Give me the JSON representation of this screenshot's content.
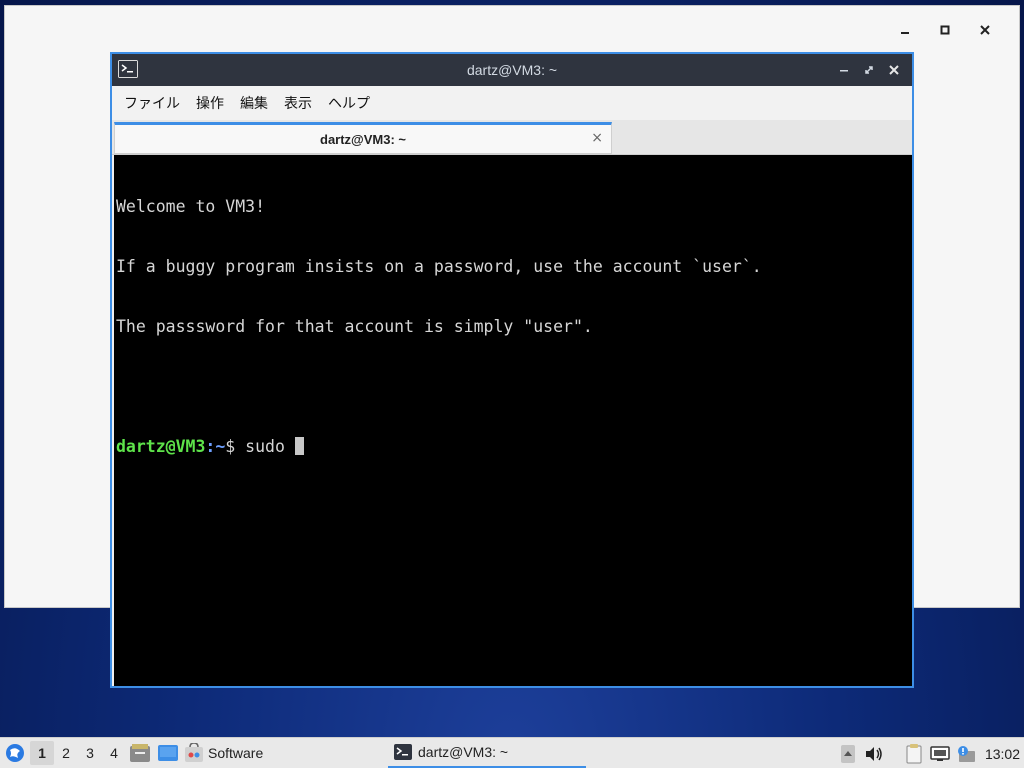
{
  "terminal_window": {
    "title": "dartz@VM3: ~",
    "menu": [
      "ファイル",
      "操作",
      "編集",
      "表示",
      "ヘルプ"
    ],
    "tab_label": "dartz@VM3: ~",
    "tab_close": "×",
    "lines": [
      "Welcome to VM3!",
      "If a buggy program insists on a password, use the account `user`.",
      "The passsword for that account is simply \"user\".",
      ""
    ],
    "prompt": {
      "user_host": "dartz@VM3",
      "sep": ":",
      "path": "~",
      "symbol": "$ ",
      "command": "sudo "
    }
  },
  "taskbar": {
    "workspaces": [
      "1",
      "2",
      "3",
      "4"
    ],
    "active_workspace": "1",
    "software_label": "Software",
    "task_title": "dartz@VM3: ~",
    "clock": "13:02"
  },
  "colors": {
    "accent": "#3d8ee6",
    "prompt_user": "#5ee34a",
    "prompt_path": "#6ea0ff"
  }
}
